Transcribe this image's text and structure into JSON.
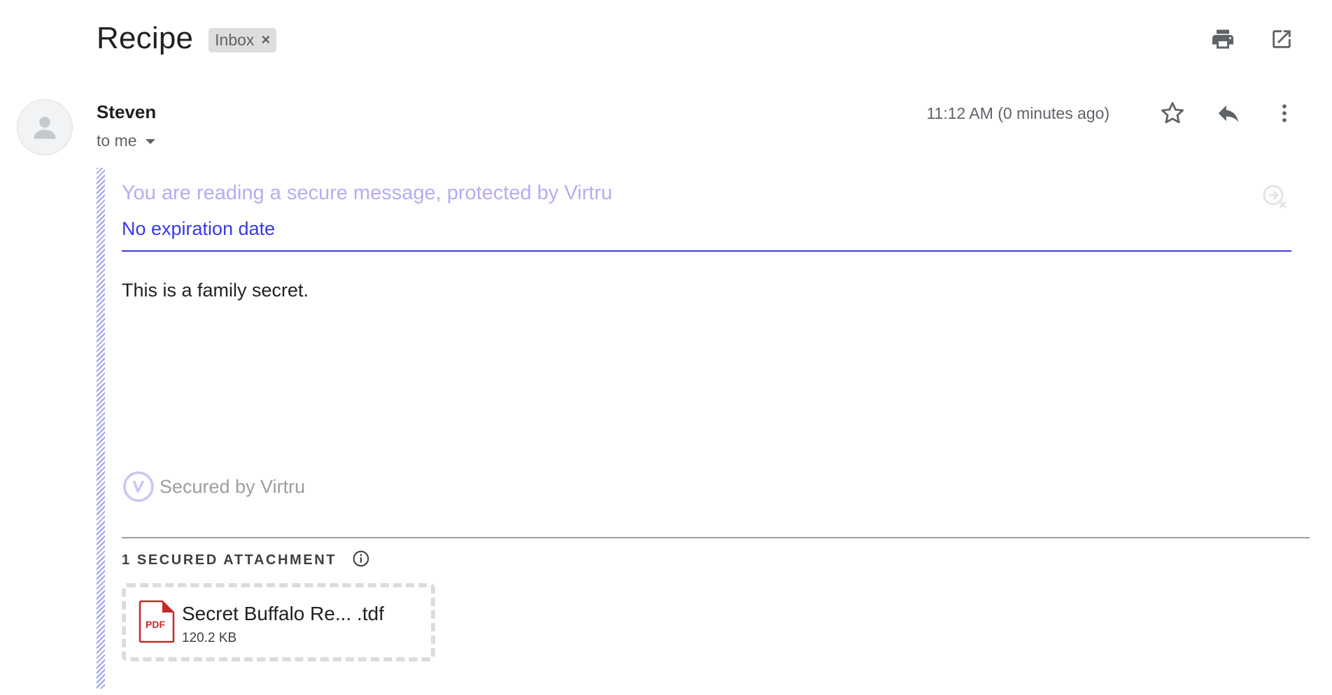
{
  "header": {
    "subject": "Recipe",
    "label_chip": "Inbox",
    "label_remove": "×"
  },
  "message": {
    "sender": "Steven",
    "recipient": "to me",
    "timestamp": "11:12 AM (0 minutes ago)"
  },
  "virtru": {
    "banner": "You are reading a secure message, protected by Virtru",
    "expiration": "No expiration date",
    "secured_by": "Secured by Virtru"
  },
  "body": {
    "text": "This is a family secret."
  },
  "attachments": {
    "title": "1 SECURED ATTACHMENT",
    "items": [
      {
        "name": "Secret Buffalo Re... .tdf",
        "size": "120.2 KB",
        "file_type": "PDF"
      }
    ]
  },
  "icons": {
    "print": "print-icon",
    "open_new_window": "open-in-new-window-icon",
    "star": "star-icon",
    "reply": "reply-icon",
    "more": "more-vert-icon",
    "info": "info-icon",
    "pdf": "pdf-file-icon",
    "virtru_logo": "virtru-logo-icon",
    "virtru_revoke": "virtru-revoke-icon"
  },
  "colors": {
    "virtru_accent": "#3b3be0",
    "virtru_light": "#b3aef0",
    "stripe": "#9fa0ee",
    "pdf_red": "#c62828"
  }
}
